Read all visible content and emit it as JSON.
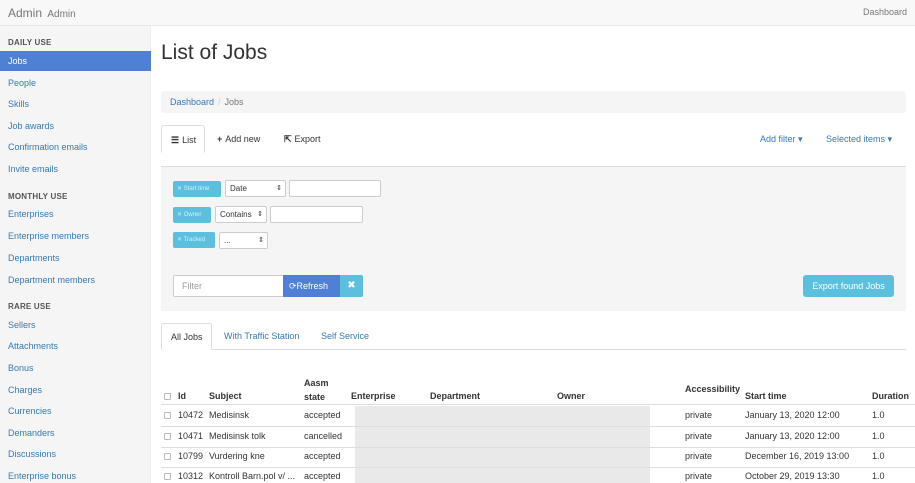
{
  "app": {
    "brand": "Admin",
    "brand_sub": "Admin",
    "top_right": "Dashboard"
  },
  "sidebar": {
    "sections": [
      {
        "title": "DAILY USE",
        "items": [
          "Jobs",
          "People",
          "Skills",
          "Job awards",
          "Confirmation emails",
          "Invite emails"
        ]
      },
      {
        "title": "MONTHLY USE",
        "items": [
          "Enterprises",
          "Enterprise members",
          "Departments",
          "Department members"
        ]
      },
      {
        "title": "RARE USE",
        "items": [
          "Sellers",
          "Attachments",
          "Bonus",
          "Charges",
          "Currencies",
          "Demanders",
          "Discussions",
          "Enterprise bonus"
        ]
      }
    ],
    "active": "Jobs"
  },
  "page": {
    "title": "List of Jobs"
  },
  "breadcrumb": {
    "home": "Dashboard",
    "separator": "/",
    "current": "Jobs"
  },
  "toolbar": {
    "list": "List",
    "add_new": "Add new",
    "export": "Export",
    "add_filter": "Add filter",
    "selected_items": "Selected items"
  },
  "filters": {
    "rows": [
      {
        "badge": "Start time",
        "select": "Date"
      },
      {
        "badge": "Owner",
        "select": "Contains"
      },
      {
        "badge": "Tracked",
        "select": "..."
      }
    ],
    "filter_placeholder": "Filter",
    "refresh": "Refresh",
    "clear": "✖",
    "export_found": "Export found Jobs"
  },
  "tabs": {
    "all": "All Jobs",
    "traffic": "With Traffic Station",
    "self": "Self Service"
  },
  "table": {
    "headers": {
      "id": "Id",
      "subject": "Subject",
      "aasm1": "Aasm",
      "aasm2": "state",
      "enterprise": "Enterprise",
      "department": "Department",
      "owner": "Owner",
      "accessibility": "Accessibility",
      "start": "Start time",
      "duration": "Duration"
    },
    "rows": [
      {
        "id": "10472",
        "subject": "Medisinsk",
        "state": "accepted",
        "access": "private",
        "start": "January 13, 2020 12:00",
        "duration": "1.0"
      },
      {
        "id": "10471",
        "subject": "Medisinsk tolk",
        "state": "cancelled",
        "access": "private",
        "start": "January 13, 2020 12:00",
        "duration": "1.0"
      },
      {
        "id": "10799",
        "subject": "Vurdering kne",
        "state": "accepted",
        "access": "private",
        "start": "December 16, 2019 13:00",
        "duration": "1.0"
      },
      {
        "id": "10312",
        "subject": "Kontroll Barn.pol v/ ...",
        "state": "accepted",
        "access": "private",
        "start": "October 29, 2019 13:30",
        "duration": "1.0"
      }
    ]
  },
  "colors": {
    "primary": "#4f80d6",
    "info": "#5bc0de",
    "link": "#337ab7"
  }
}
